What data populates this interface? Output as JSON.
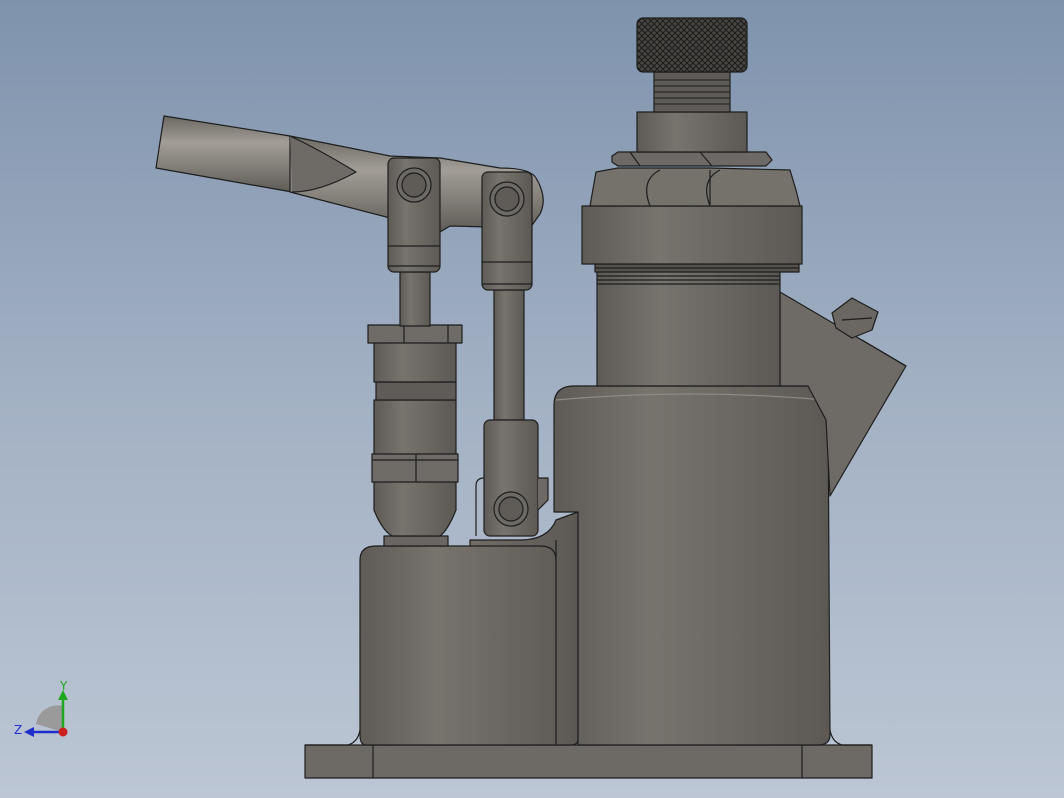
{
  "triad": {
    "y_label": "Y",
    "z_label": "Z",
    "y_color": "#1fa81f",
    "z_color": "#1f2fcc",
    "x_color": "#cc1f1f"
  },
  "colors": {
    "background_top": "#7f93ad",
    "background_bottom": "#bcc6d4",
    "metal": "#6f6b66",
    "metal_light": "#8a867f",
    "outline": "#1e1e1e"
  }
}
